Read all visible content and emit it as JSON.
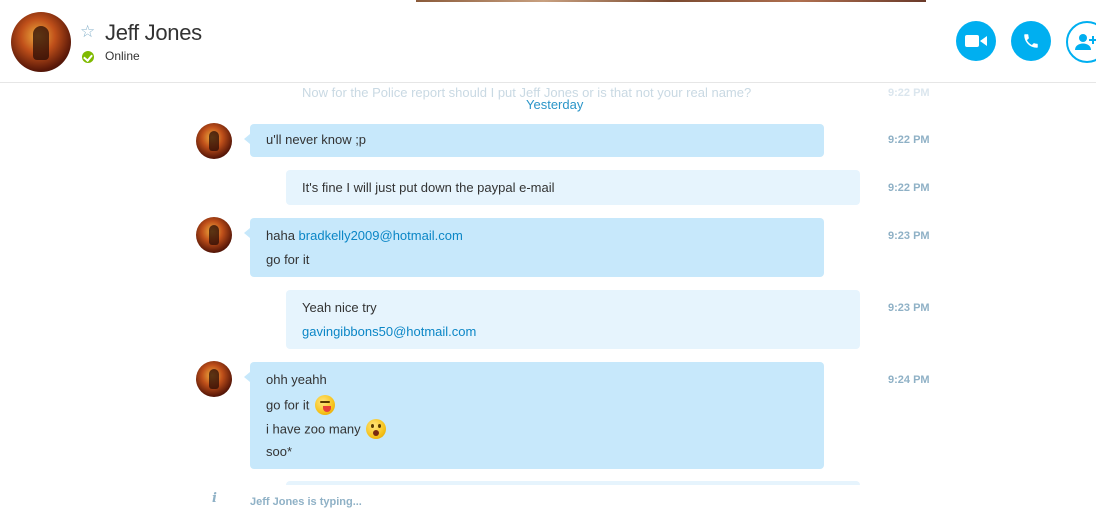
{
  "contact": {
    "name": "Jeff Jones",
    "status": "Online"
  },
  "header_actions": {
    "video_call": "video-camera-icon",
    "audio_call": "phone-icon",
    "add_people": "add-person-icon"
  },
  "colors": {
    "accent": "#00aff0",
    "incoming_bubble": "#c7e8fb",
    "outgoing_bubble": "#e6f4fd",
    "online": "#7fba00",
    "link": "#0b86c6"
  },
  "conversation": {
    "faded_previous_message": "Now for the Police report should I put Jeff Jones or is that not your real name?",
    "faded_previous_time": "9:22 PM",
    "day_separator": "Yesterday",
    "messages": [
      {
        "direction": "incoming",
        "lines": [
          "u'll never know ;p"
        ],
        "time": "9:22 PM"
      },
      {
        "direction": "outgoing",
        "lines": [
          "It's fine I will just put down the paypal e-mail"
        ],
        "time": "9:22 PM"
      },
      {
        "direction": "incoming",
        "text_prefix": "haha ",
        "link": "bradkelly2009@hotmail.com",
        "lines": [
          "go for it"
        ],
        "time": "9:23 PM"
      },
      {
        "direction": "outgoing",
        "lines": [
          "Yeah nice try"
        ],
        "link": "gavingibbons50@hotmail.com",
        "time": "9:23 PM"
      },
      {
        "direction": "incoming",
        "lines": [
          "ohh yeahh",
          "go for it",
          "i have zoo many",
          "soo*"
        ],
        "emoticons": [
          "tongue-emoticon",
          "shocked-emoticon"
        ],
        "time": "9:24 PM"
      }
    ],
    "typing_indicator": "Jeff Jones is typing..."
  }
}
